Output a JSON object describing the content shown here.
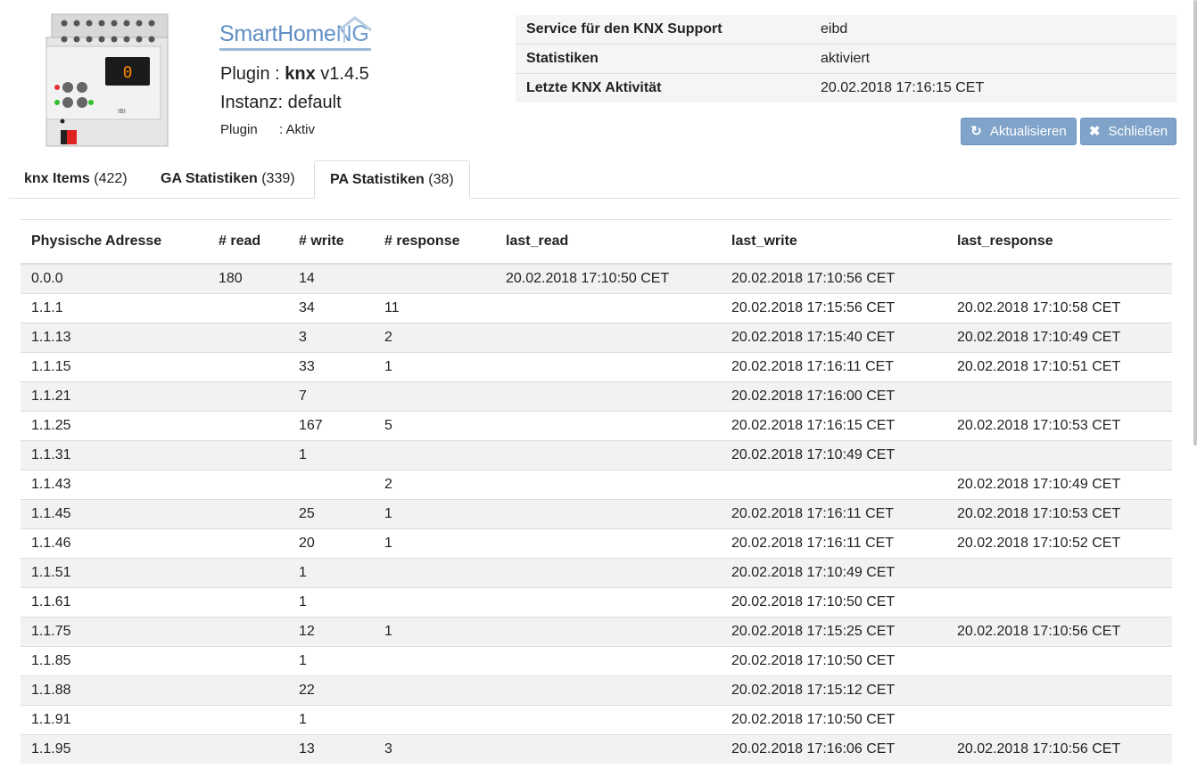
{
  "header": {
    "logo_text": "SmartHome",
    "logo_ng": "NG",
    "plugin_prefix": "Plugin : ",
    "plugin_name": "knx",
    "plugin_version": "v1.4.5",
    "instanz": "Instanz: default",
    "status_label": "Plugin",
    "status_value": ": Aktiv",
    "device_display": "0"
  },
  "info": [
    {
      "key": "Service für den KNX Support",
      "value": "eibd"
    },
    {
      "key": "Statistiken",
      "value": "aktiviert"
    },
    {
      "key": "Letzte KNX Aktivität",
      "value": "20.02.2018 17:16:15 CET"
    }
  ],
  "buttons": {
    "refresh_label": "Aktualisieren",
    "close_label": "Schließen"
  },
  "tabs": [
    {
      "label": "knx Items",
      "count": "(422)"
    },
    {
      "label": "GA Statistiken",
      "count": "(339)"
    },
    {
      "label": "PA Statistiken",
      "count": "(38)",
      "active": true
    }
  ],
  "table": {
    "columns": [
      "Physische Adresse",
      "# read",
      "# write",
      "# response",
      "last_read",
      "last_write",
      "last_response"
    ],
    "rows": [
      [
        "0.0.0",
        "180",
        "14",
        "",
        "20.02.2018 17:10:50 CET",
        "20.02.2018 17:10:56 CET",
        ""
      ],
      [
        "1.1.1",
        "",
        "34",
        "11",
        "",
        "20.02.2018 17:15:56 CET",
        "20.02.2018 17:10:58 CET"
      ],
      [
        "1.1.13",
        "",
        "3",
        "2",
        "",
        "20.02.2018 17:15:40 CET",
        "20.02.2018 17:10:49 CET"
      ],
      [
        "1.1.15",
        "",
        "33",
        "1",
        "",
        "20.02.2018 17:16:11 CET",
        "20.02.2018 17:10:51 CET"
      ],
      [
        "1.1.21",
        "",
        "7",
        "",
        "",
        "20.02.2018 17:16:00 CET",
        ""
      ],
      [
        "1.1.25",
        "",
        "167",
        "5",
        "",
        "20.02.2018 17:16:15 CET",
        "20.02.2018 17:10:53 CET"
      ],
      [
        "1.1.31",
        "",
        "1",
        "",
        "",
        "20.02.2018 17:10:49 CET",
        ""
      ],
      [
        "1.1.43",
        "",
        "",
        "2",
        "",
        "",
        "20.02.2018 17:10:49 CET"
      ],
      [
        "1.1.45",
        "",
        "25",
        "1",
        "",
        "20.02.2018 17:16:11 CET",
        "20.02.2018 17:10:53 CET"
      ],
      [
        "1.1.46",
        "",
        "20",
        "1",
        "",
        "20.02.2018 17:16:11 CET",
        "20.02.2018 17:10:52 CET"
      ],
      [
        "1.1.51",
        "",
        "1",
        "",
        "",
        "20.02.2018 17:10:49 CET",
        ""
      ],
      [
        "1.1.61",
        "",
        "1",
        "",
        "",
        "20.02.2018 17:10:50 CET",
        ""
      ],
      [
        "1.1.75",
        "",
        "12",
        "1",
        "",
        "20.02.2018 17:15:25 CET",
        "20.02.2018 17:10:56 CET"
      ],
      [
        "1.1.85",
        "",
        "1",
        "",
        "",
        "20.02.2018 17:10:50 CET",
        ""
      ],
      [
        "1.1.88",
        "",
        "22",
        "",
        "",
        "20.02.2018 17:15:12 CET",
        ""
      ],
      [
        "1.1.91",
        "",
        "1",
        "",
        "",
        "20.02.2018 17:10:50 CET",
        ""
      ],
      [
        "1.1.95",
        "",
        "13",
        "3",
        "",
        "20.02.2018 17:16:06 CET",
        "20.02.2018 17:10:56 CET"
      ]
    ]
  }
}
